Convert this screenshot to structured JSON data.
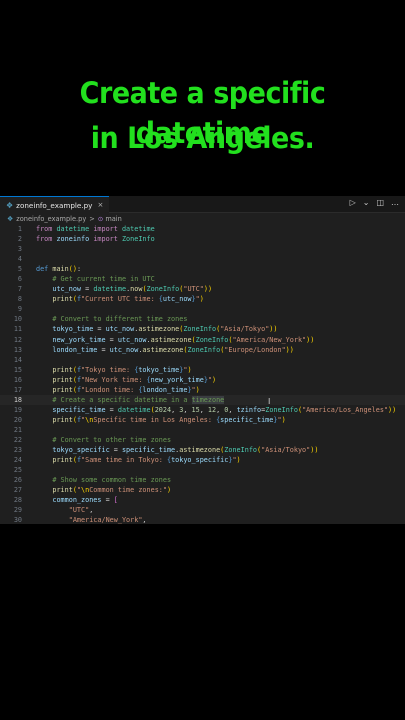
{
  "headline": {
    "line1": "Create a specific datetime",
    "line2": "in Los Angeles."
  },
  "editor": {
    "tab_label": "zoneinfo_example.py",
    "breadcrumb": {
      "file": "zoneinfo_example.py",
      "separator": ">",
      "function": "main"
    },
    "current_line": 18,
    "lines": [
      {
        "n": "1",
        "code": "from datetime import datetime"
      },
      {
        "n": "2",
        "code": "from zoneinfo import ZoneInfo"
      },
      {
        "n": "3",
        "code": ""
      },
      {
        "n": "4",
        "code": ""
      },
      {
        "n": "5",
        "code": "def main():"
      },
      {
        "n": "6",
        "code": "    # Get current time in UTC"
      },
      {
        "n": "7",
        "code": "    utc_now = datetime.now(ZoneInfo(\"UTC\"))"
      },
      {
        "n": "8",
        "code": "    print(f\"Current UTC time: {utc_now}\")"
      },
      {
        "n": "9",
        "code": ""
      },
      {
        "n": "10",
        "code": "    # Convert to different time zones"
      },
      {
        "n": "11",
        "code": "    tokyo_time = utc_now.astimezone(ZoneInfo(\"Asia/Tokyo\"))"
      },
      {
        "n": "12",
        "code": "    new_york_time = utc_now.astimezone(ZoneInfo(\"America/New_York\"))"
      },
      {
        "n": "13",
        "code": "    london_time = utc_now.astimezone(ZoneInfo(\"Europe/London\"))"
      },
      {
        "n": "14",
        "code": ""
      },
      {
        "n": "15",
        "code": "    print(f\"Tokyo time: {tokyo_time}\")"
      },
      {
        "n": "16",
        "code": "    print(f\"New York time: {new_york_time}\")"
      },
      {
        "n": "17",
        "code": "    print(f\"London time: {london_time}\")"
      },
      {
        "n": "18",
        "code": "    # Create a specific datetime in a timezone"
      },
      {
        "n": "19",
        "code": "    specific_time = datetime(2024, 3, 15, 12, 0, tzinfo=ZoneInfo(\"America/Los_Angeles\"))"
      },
      {
        "n": "20",
        "code": "    print(f\"\\nSpecific time in Los Angeles: {specific_time}\")"
      },
      {
        "n": "21",
        "code": ""
      },
      {
        "n": "22",
        "code": "    # Convert to other time zones"
      },
      {
        "n": "23",
        "code": "    tokyo_specific = specific_time.astimezone(ZoneInfo(\"Asia/Tokyo\"))"
      },
      {
        "n": "24",
        "code": "    print(f\"Same time in Tokyo: {tokyo_specific}\")"
      },
      {
        "n": "25",
        "code": ""
      },
      {
        "n": "26",
        "code": "    # Show some common time zones"
      },
      {
        "n": "27",
        "code": "    print(\"\\nCommon time zones:\")"
      },
      {
        "n": "28",
        "code": "    common_zones = ["
      },
      {
        "n": "29",
        "code": "        \"UTC\","
      },
      {
        "n": "30",
        "code": "        \"America/New_York\","
      }
    ]
  },
  "colors": {
    "headline": "#22e01e",
    "editor_bg": "#1f1f1f",
    "keyword": "#c586c0",
    "string": "#ce9178",
    "comment": "#6a9955"
  }
}
